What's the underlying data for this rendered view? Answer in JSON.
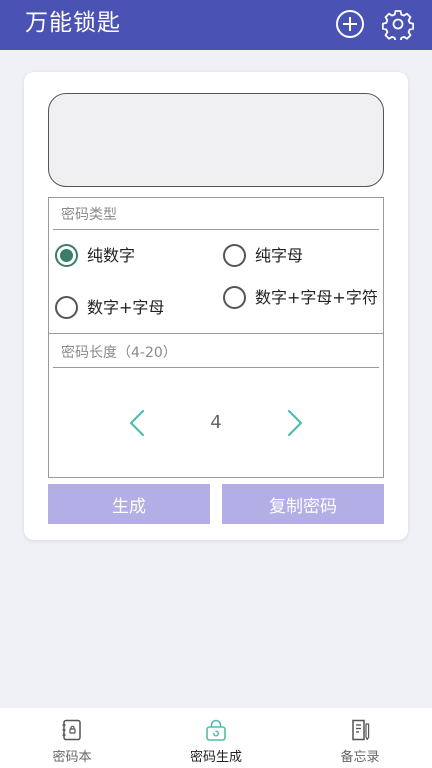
{
  "header": {
    "title": "万能锁匙",
    "add_icon": "plus-circle-icon",
    "settings_icon": "gear-icon"
  },
  "generator": {
    "password_output": "",
    "type_section": {
      "label": "密码类型",
      "options": [
        {
          "label": "纯数字",
          "checked": true
        },
        {
          "label": "纯字母",
          "checked": false
        },
        {
          "label": "数字+字母",
          "checked": false
        },
        {
          "label": "数字+字母+字符",
          "checked": false
        }
      ]
    },
    "length_section": {
      "label": "密码长度（4-20）",
      "value": "4"
    },
    "generate_label": "生成",
    "copy_label": "复制密码"
  },
  "tabs": [
    {
      "label": "密码本",
      "icon": "notebook-icon",
      "active": false
    },
    {
      "label": "密码生成",
      "icon": "lock-icon",
      "active": true
    },
    {
      "label": "备忘录",
      "icon": "memo-icon",
      "active": false
    }
  ],
  "colors": {
    "header": "#4a52b4",
    "accent_teal": "#4fbdad",
    "radio_checked": "#3a7d68",
    "button": "#b3aee6",
    "background": "#f0f1f6"
  }
}
